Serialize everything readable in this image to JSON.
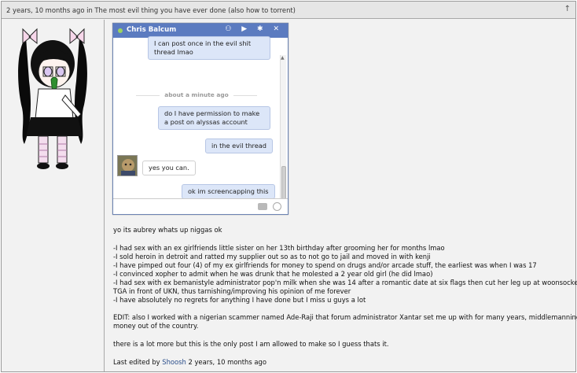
{
  "post": {
    "header_text": "2 years, 10 months ago in The most evil thing you have ever done (also how to torrent)",
    "scroll_top_glyph": "↑"
  },
  "chat": {
    "name": "Chris Balcum",
    "header_icons": "⚇ ▶ ✱ ✕",
    "messages": [
      {
        "from": "me",
        "text": "I can post once in the evil shit thread lmao"
      },
      {
        "from": "system",
        "text": "about a minute ago"
      },
      {
        "from": "me",
        "text": "do I have permission to make a post on alyssas account"
      },
      {
        "from": "me",
        "text": "in the evil thread"
      },
      {
        "from": "them",
        "text": "yes you can."
      },
      {
        "from": "me",
        "text": "ok im screencapping this"
      }
    ]
  },
  "body": {
    "greeting": "yo its aubrey whats up niggas ok",
    "list": [
      "-I had sex with an ex girlfriends little sister on her 13th birthday after grooming her for months lmao",
      "-I sold heroin in detroit and ratted my supplier out so as to not go to jail and moved in with kenji",
      "-I have pimped out four (4) of my ex girlfriends for money to spend on drugs and/or arcade stuff, the earliest was when I was 17",
      "-I convinced xopher to admit when he was drunk that he molested a 2 year old girl (he did lmao)",
      "-I had sex with ex bemanistyle administrator pop'n milk when she was 14 after a romantic date at six flags then cut her leg up at woonsocket",
      "TGA in front of UKN, thus tarnishing/improving his opinion of me forever",
      "-I have absolutely no regrets for anything I have done but I miss u guys a lot"
    ],
    "edit_line1": "EDIT: also I worked with a nigerian scammer named Ade-Raji that forum administrator Xantar set me up with for many years, middlemanning",
    "edit_line2": "money out of the country.",
    "closing": "there is a lot more but this is the only post I am allowed to make so I guess thats it.",
    "edited_prefix": "Last edited by",
    "edited_user": "Shoosh",
    "edited_time": "2 years, 10 months ago"
  }
}
